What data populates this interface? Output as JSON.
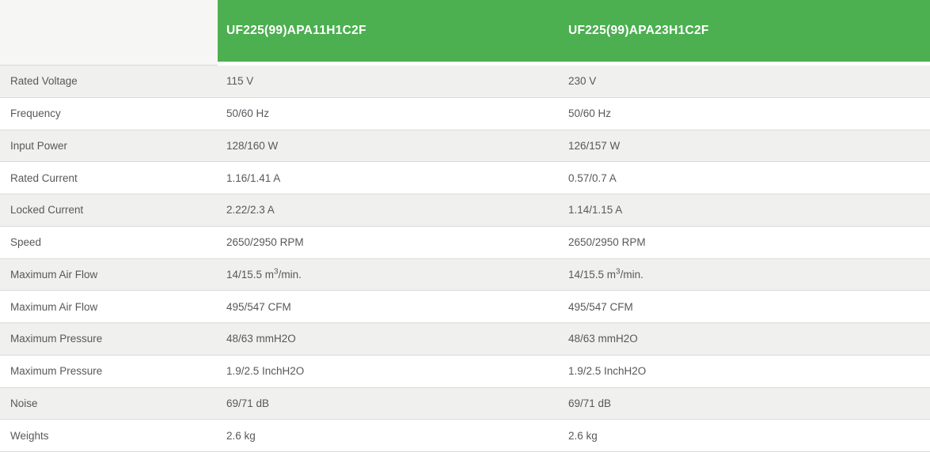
{
  "table": {
    "header": {
      "corner": "",
      "columns": [
        "UF225(99)APA11H1C2F",
        "UF225(99)APA23H1C2F"
      ]
    },
    "rows": [
      {
        "label": "Rated Voltage",
        "values": [
          "115 V",
          "230 V"
        ]
      },
      {
        "label": "Frequency",
        "values": [
          "50/60 Hz",
          "50/60 Hz"
        ]
      },
      {
        "label": "Input Power",
        "values": [
          "128/160 W",
          "126/157 W"
        ]
      },
      {
        "label": "Rated Current",
        "values": [
          "1.16/1.41 A",
          "0.57/0.7 A"
        ]
      },
      {
        "label": "Locked Current",
        "values": [
          "2.22/2.3 A",
          "1.14/1.15 A"
        ]
      },
      {
        "label": "Speed",
        "values": [
          "2650/2950 RPM",
          "2650/2950 RPM"
        ]
      },
      {
        "label": "Maximum Air Flow",
        "values": [
          "14/15.5 m³/min.",
          "14/15.5 m³/min."
        ]
      },
      {
        "label": "Maximum Air Flow",
        "values": [
          "495/547 CFM",
          "495/547 CFM"
        ]
      },
      {
        "label": "Maximum Pressure",
        "values": [
          "48/63 mmH2O",
          "48/63 mmH2O"
        ]
      },
      {
        "label": "Maximum Pressure",
        "values": [
          "1.9/2.5 InchH2O",
          "1.9/2.5 InchH2O"
        ]
      },
      {
        "label": "Noise",
        "values": [
          "69/71 dB",
          "69/71 dB"
        ]
      },
      {
        "label": "Weights",
        "values": [
          "2.6 kg",
          "2.6 kg"
        ]
      }
    ],
    "colors": {
      "header_bg": "#4caf50",
      "header_text": "#ffffff",
      "corner_bg": "#f6f6f4",
      "row_alt_bg": "#f0f0ee",
      "row_bg": "#ffffff",
      "border": "#d9d9d9",
      "text": "#57585a"
    }
  }
}
